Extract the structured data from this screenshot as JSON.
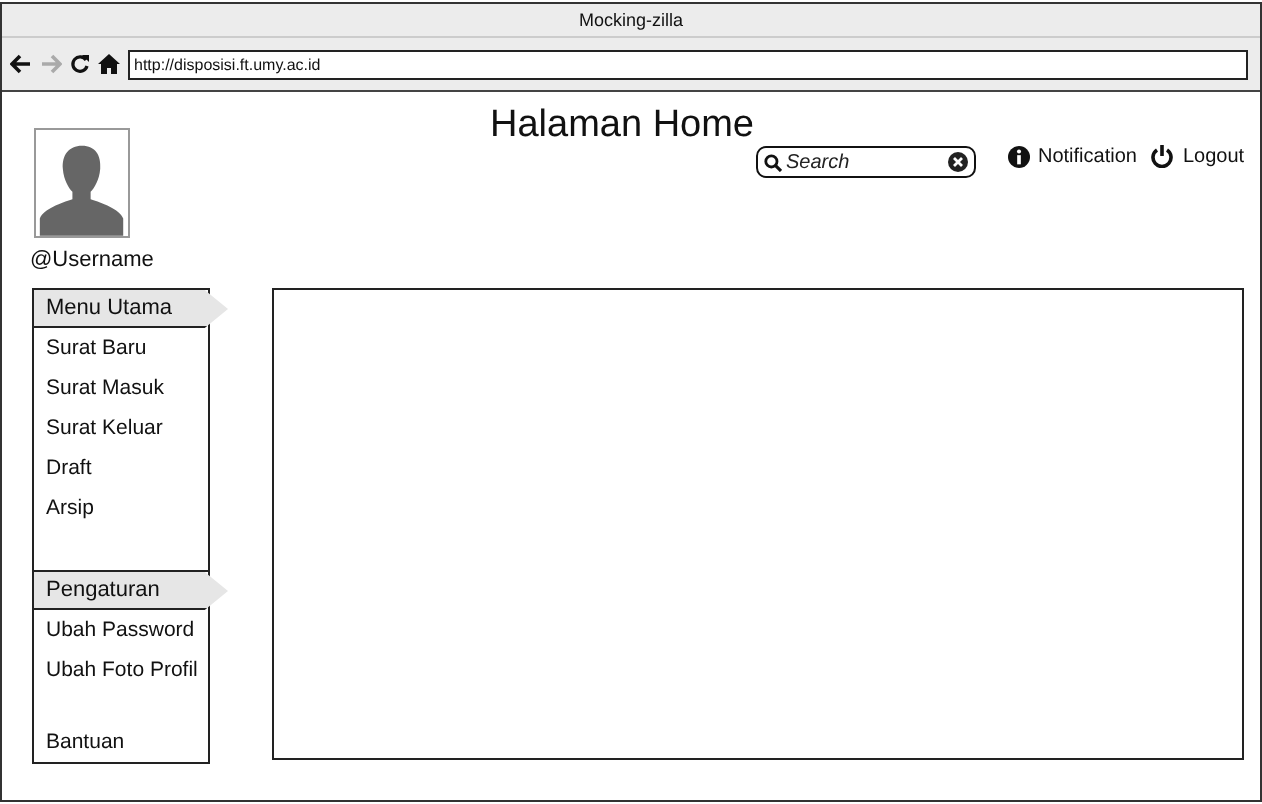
{
  "window": {
    "title": "Mocking-zilla"
  },
  "address_bar": {
    "url": "http://disposisi.ft.umy.ac.id"
  },
  "header": {
    "title": "Halaman Home",
    "search": {
      "placeholder": "Search"
    },
    "actions": [
      {
        "kind": "info",
        "label": "Notification"
      },
      {
        "kind": "power",
        "label": "Logout"
      }
    ]
  },
  "user": {
    "username": "@Username"
  },
  "menu_groups": [
    {
      "title": "Menu Utama",
      "items": [
        "Surat Baru",
        "Surat Masuk",
        "Surat Keluar",
        "Draft",
        "Arsip"
      ]
    },
    {
      "title": "Pengaturan",
      "items": [
        "Ubah Password",
        "Ubah Foto Profil"
      ],
      "footer_item": "Bantuan"
    }
  ]
}
